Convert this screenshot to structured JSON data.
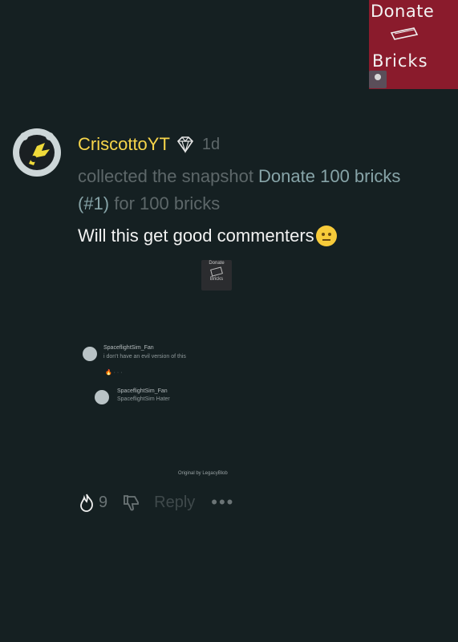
{
  "snapshot_thumb": {
    "line1": "Donate",
    "line2": "Bricks"
  },
  "post": {
    "username": "CriscottoYT",
    "badge_icon": "diamond-badge-icon",
    "time": "1d",
    "activity_prefix": "collected the snapshot ",
    "activity_link": "Donate 100 bricks (#1)",
    "activity_suffix": " for 100 bricks",
    "message": "Will this get good commenters",
    "emoji": "neutral-face-emoji"
  },
  "attachment": {
    "line1": "Donate",
    "line2": "Bricks"
  },
  "embedded_comments": [
    {
      "author": "SpaceflightSim_Fan",
      "text": "i don't have an evil version of this"
    },
    {
      "author": "SpaceflightSim_Fan",
      "text": "SpaceflightSim Hater"
    }
  ],
  "embedded_credit": "Original by LegacyBlob",
  "actions": {
    "like_count": "9",
    "reply_label": "Reply",
    "more_label": "•••"
  },
  "colors": {
    "background": "#152022",
    "username": "#f6d54a",
    "muted": "#5d6769",
    "link": "#87a4a8"
  }
}
